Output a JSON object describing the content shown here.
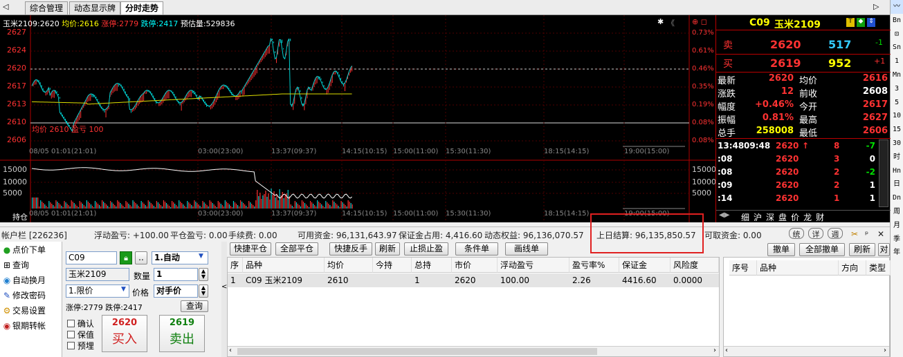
{
  "tabs": [
    "综合管理",
    "动态显示牌",
    "分时走势"
  ],
  "right_toolbar": [
    "Bn",
    "Sn",
    "1",
    "Mn",
    "3",
    "5",
    "10",
    "15",
    "30",
    "时",
    "Hn",
    "日",
    "Dn",
    "周",
    "月",
    "季",
    "年"
  ],
  "chart": {
    "header": {
      "name_price": "玉米2109:2620",
      "avg_label": "均价:",
      "avg": "2616",
      "up_limit": "涨停:2779",
      "down_limit": "跌停:2417",
      "estimate": "预估量:529836"
    },
    "price_axis": [
      "2627",
      "2624",
      "2620",
      "2617",
      "2613",
      "2610",
      "2606"
    ],
    "pct_axis": [
      "0.73%",
      "0.61%",
      "0.46%",
      "0.35%",
      "0.19%",
      "0.08%",
      "0.08%"
    ],
    "vol_axis": [
      "15000",
      "10000",
      "5000"
    ],
    "time_axis": [
      "08/05 01:01(21:01)",
      "03:00(23:00)",
      "13:37(09:37)",
      "14:15(10:15)",
      "15:00(11:00)",
      "15:30(11:30)",
      "18:15(14:15)",
      "19:00(15:00)"
    ],
    "annotation": "均价 2610  盈亏 100",
    "holding_label": "持仓"
  },
  "quote": {
    "code": "C09",
    "name": "玉米2109",
    "sell_label": "卖",
    "sell_price": "2620",
    "sell_vol": "517",
    "sell_chg": "-1",
    "buy_label": "买",
    "buy_price": "2619",
    "buy_vol": "952",
    "buy_chg": "+1",
    "rows": [
      {
        "l": "最新",
        "v": "2620",
        "l2": "均价",
        "v2": "2616"
      },
      {
        "l": "涨跌",
        "v": "12",
        "l2": "前收",
        "v2": "2608"
      },
      {
        "l": "幅度",
        "v": "+0.46%",
        "l2": "今开",
        "v2": "2617"
      },
      {
        "l": "振幅",
        "v": "0.81%",
        "l2": "最高",
        "v2": "2627"
      },
      {
        "l": "总手",
        "v": "258008",
        "l2": "最低",
        "v2": "2606"
      }
    ],
    "ticks": [
      {
        "t": "13:48",
        "t2": "09:48",
        "p": "2620",
        "a": "↑",
        "v": "8",
        "c": "-7"
      },
      {
        "t": ":08",
        "t2": "",
        "p": "2620",
        "a": "",
        "v": "3",
        "c": "0"
      },
      {
        "t": ":08",
        "t2": "",
        "p": "2620",
        "a": "",
        "v": "2",
        "c": "-2"
      },
      {
        "t": ":09",
        "t2": "",
        "p": "2620",
        "a": "",
        "v": "2",
        "c": "1"
      },
      {
        "t": ":14",
        "t2": "",
        "p": "2620",
        "a": "",
        "v": "1",
        "c": "1"
      }
    ],
    "bottom_tabs": [
      "细",
      "沪",
      "深",
      "盘",
      "价",
      "龙",
      "财"
    ]
  },
  "account": {
    "acct": "帐户栏 [226236]",
    "float": "浮动盈亏: +100.00",
    "close": "平仓盈亏: 0.00",
    "fee": "手续费: 0.00",
    "avail": "可用资金: 96,131,643.97",
    "margin": "保证金占用: 4,416.60",
    "equity": "动态权益: 96,136,070.57",
    "settle": "上日结算: 96,135,850.57",
    "withdraw": "可取资金: 0.00",
    "btns": [
      "统",
      "详",
      "週"
    ]
  },
  "nav": [
    "点价下单",
    "查询",
    "自动换月",
    "修改密码",
    "交易设置",
    "银期转帐"
  ],
  "order": {
    "code": "C09",
    "mode": "1.自动",
    "name": "玉米2109",
    "qty_label": "数量",
    "qty": "1",
    "price_type": "1.限价",
    "price_label": "价格",
    "price": "对手价",
    "limits": "涨停:2779 跌停:2417",
    "query": "查询",
    "checks": [
      "确认",
      "保值",
      "预埋"
    ],
    "buy_price": "2620",
    "buy_label": "买入",
    "sell_price": "2619",
    "sell_label": "卖出"
  },
  "toolbar": [
    "快捷平仓",
    "全部平仓",
    "快捷反手",
    "刷新",
    "止损止盈",
    "条件单",
    "画线单"
  ],
  "positions": {
    "headers": [
      "序",
      "品种",
      "均价",
      "今持",
      "总持",
      "市价",
      "浮动盈亏",
      "盈亏率%",
      "保证金",
      "风险度"
    ],
    "rows": [
      [
        "1",
        "C09 玉米2109",
        "2610",
        "",
        "1",
        "2620",
        "100.00",
        "2.26",
        "4416.60",
        "0.0000"
      ]
    ]
  },
  "orders_panel": {
    "btns": [
      "撤单",
      "全部撤单",
      "刷新",
      "对"
    ],
    "headers": [
      "序号",
      "品种",
      "方向",
      "类型"
    ]
  },
  "colors": {
    "up": "#ff3232",
    "down": "#00e000",
    "bg": "#000000",
    "grid": "#7a0000"
  }
}
